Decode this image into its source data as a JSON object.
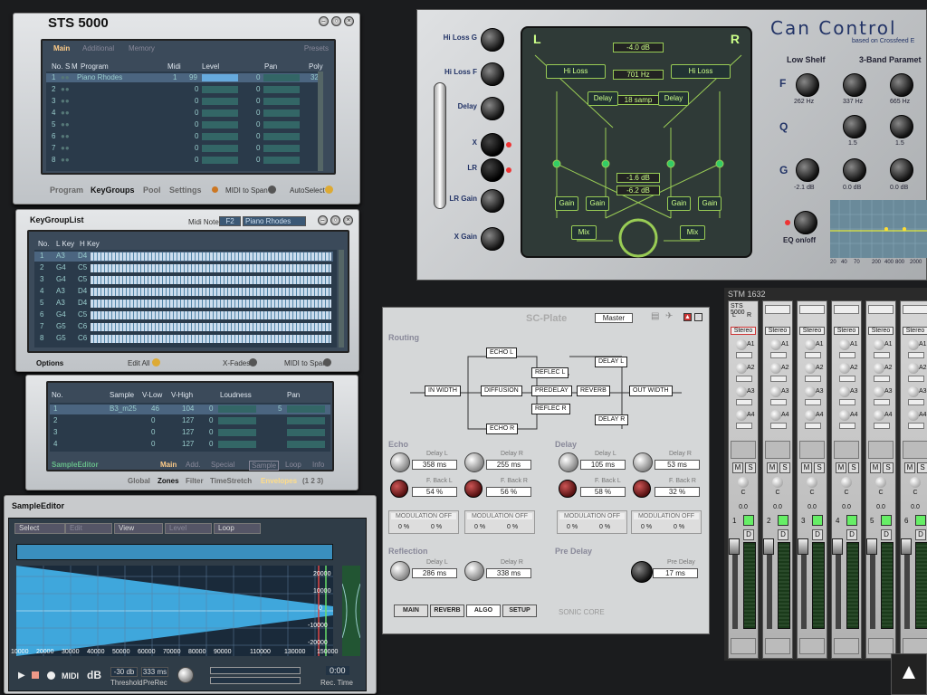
{
  "sts": {
    "title": "STS 5000",
    "tabs": [
      "Main",
      "Additional",
      "Memory"
    ],
    "presets": "Presets",
    "cols": [
      "No.",
      "S",
      "M",
      "Program",
      "Midi",
      "Level",
      "Pan",
      "Poly"
    ],
    "rows": [
      [
        "1",
        "Piano Rhodes",
        "1",
        "99",
        "0",
        "32"
      ],
      [
        "2",
        "",
        "",
        "0",
        "0",
        ""
      ],
      [
        "3",
        "",
        "",
        "0",
        "0",
        ""
      ],
      [
        "4",
        "",
        "",
        "0",
        "0",
        ""
      ],
      [
        "5",
        "",
        "",
        "0",
        "0",
        ""
      ],
      [
        "6",
        "",
        "",
        "0",
        "0",
        ""
      ],
      [
        "7",
        "",
        "",
        "0",
        "0",
        ""
      ],
      [
        "8",
        "",
        "",
        "0",
        "0",
        ""
      ]
    ],
    "bottom": [
      "Program",
      "KeyGroups",
      "Pool",
      "Settings"
    ],
    "midi_to_span": "MIDI to Span",
    "autoselect": "AutoSelect"
  },
  "kgl": {
    "title": "KeyGroupList",
    "midi_note_label": "Midi Note",
    "midi_note": "F2",
    "program": "Piano Rhodes",
    "cols": [
      "No.",
      "L Key",
      "H Key"
    ],
    "rows": [
      [
        "1",
        "A3",
        "D4"
      ],
      [
        "2",
        "G4",
        "C5"
      ],
      [
        "3",
        "G4",
        "C5"
      ],
      [
        "4",
        "A3",
        "D4"
      ],
      [
        "5",
        "A3",
        "D4"
      ],
      [
        "6",
        "G4",
        "C5"
      ],
      [
        "7",
        "G5",
        "C6"
      ],
      [
        "8",
        "G5",
        "C6"
      ]
    ],
    "options": "Options",
    "edit_all": "Edit All",
    "xfades": "X-Fades",
    "midi_to_span": "MIDI to Span"
  },
  "samp": {
    "cols": [
      "No.",
      "Sample",
      "V-Low",
      "V-High",
      "Loudness",
      "Pan"
    ],
    "rows": [
      [
        "1",
        "B3_m25",
        "46",
        "104",
        "0",
        "5"
      ],
      [
        "2",
        "",
        "0",
        "127",
        "0",
        ""
      ],
      [
        "3",
        "",
        "0",
        "127",
        "0",
        ""
      ],
      [
        "4",
        "",
        "0",
        "127",
        "0",
        ""
      ]
    ],
    "name": "SampleEditor",
    "tabs": [
      "Main",
      "Add.",
      "Special"
    ],
    "tabs2": [
      "Sample",
      "Loop",
      "Info"
    ],
    "nav": [
      "Global",
      "Zones",
      "Filter",
      "TimeStretch",
      "Envelopes",
      "(1 2 3)"
    ]
  },
  "se": {
    "title": "SampleEditor",
    "menu": [
      "Select",
      "Edit",
      "View",
      "Level",
      "Loop"
    ],
    "yticks": [
      "20000",
      "10000",
      "0",
      "-10000",
      "-20000"
    ],
    "xticks": [
      "10000",
      "20000",
      "30000",
      "40000",
      "50000",
      "60000",
      "70000",
      "80000",
      "90000",
      "110000",
      "130000",
      "150000"
    ],
    "midi": "MIDI",
    "db": "dB",
    "threshold_val": "-30 db",
    "threshold": "Threshold",
    "prerec_val": "333 ms",
    "prerec": "PreRec",
    "time_val": "0:00",
    "rec_time": "Rec. Time"
  },
  "can": {
    "title": "Can Control",
    "subtitle": "based on Crossfeed E",
    "left_labels": [
      "Hi Loss G",
      "Hi Loss F",
      "Delay",
      "X",
      "LR",
      "LR Gain",
      "X Gain"
    ],
    "L": "L",
    "R": "R",
    "db_top": "-4.0 dB",
    "hz": "701 Hz",
    "samp": "18 samp",
    "db_a": "-1.6 dB",
    "db_b": "-6.2 dB",
    "hiloss": "Hi Loss",
    "delay": "Delay",
    "gain": "Gain",
    "mix": "Mix",
    "low_shelf": "Low Shelf",
    "param": "3-Band Paramet",
    "F": "F",
    "Q": "Q",
    "G": "G",
    "hz1": "262 Hz",
    "hz2": "337 Hz",
    "hz3": "665 Hz",
    "q1": "1.5",
    "q2": "1.5",
    "g1": "-2.1 dB",
    "g2": "0.0 dB",
    "g3": "0.0 dB",
    "eq": "EQ on/off",
    "axis": [
      "20",
      "40",
      "70",
      "200",
      "400",
      "800",
      "2000"
    ]
  },
  "plate": {
    "title": "SC-Plate",
    "preset": "Master",
    "routing": "Routing",
    "nodes": [
      "ECHO L",
      "ECHO R",
      "IN WIDTH",
      "DIFFUSION",
      "REFLEC L",
      "PREDELAY",
      "REFLEC R",
      "REVERB",
      "DELAY L",
      "DELAY R",
      "OUT WIDTH"
    ],
    "echo": "Echo",
    "delay": "Delay",
    "reflection": "Reflection",
    "predelay": "Pre Delay",
    "echo_dl": "Delay L",
    "echo_dl_v": "358 ms",
    "echo_dr": "Delay R",
    "echo_dr_v": "255 ms",
    "echo_fl": "F. Back L",
    "echo_fl_v": "54 %",
    "echo_fr": "F. Back R",
    "echo_fr_v": "56 %",
    "del_dl_v": "105 ms",
    "del_dr_v": "53 ms",
    "del_fl_v": "58 %",
    "del_fr_v": "32 %",
    "ref_dl_v": "286 ms",
    "ref_dr_v": "338 ms",
    "pre_v": "17 ms",
    "mod": "MODULATION OFF",
    "pct": "0 %",
    "tabs": [
      "MAIN",
      "REVERB",
      "ALGO",
      "SETUP"
    ],
    "brand": "SONIC CORE"
  },
  "stm": {
    "title": "STM 1632",
    "ch1": "STS 5000",
    "lr": [
      "L",
      "R"
    ],
    "stereo": "Stereo",
    "aux": [
      "A1",
      "A2",
      "A3",
      "A4"
    ],
    "ms": [
      "M",
      "S"
    ],
    "c": "C",
    "zero": "0.0",
    "d": "D",
    "channels": [
      "1",
      "2",
      "3",
      "4",
      "5",
      "6"
    ]
  }
}
